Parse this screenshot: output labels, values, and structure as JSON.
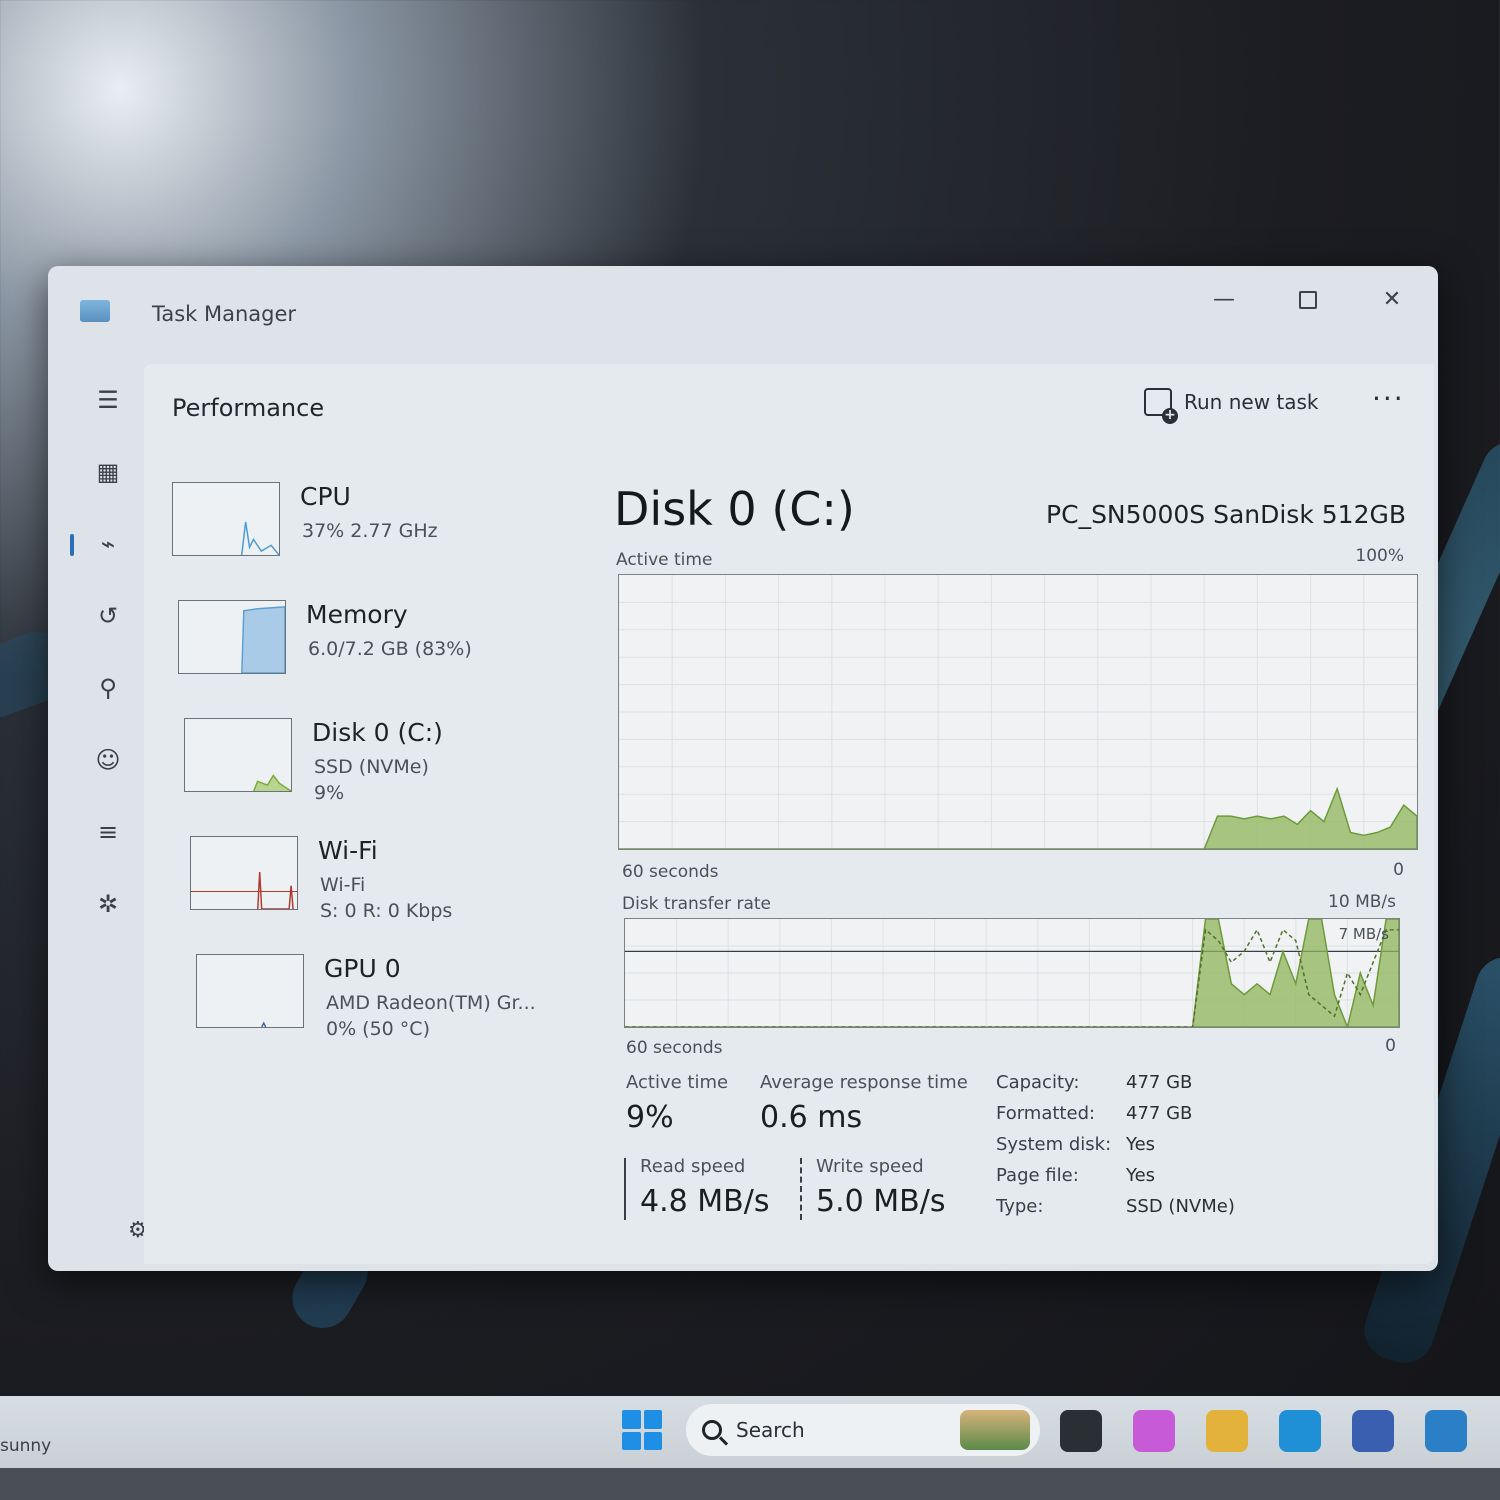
{
  "window": {
    "title": "Task Manager",
    "minimize": "—",
    "close": "✕"
  },
  "header": {
    "section": "Performance",
    "run_new_task": "Run new task",
    "more": "···"
  },
  "nav": {
    "items": [
      {
        "name": "menu",
        "icon": "hamburger-icon",
        "glyph": "☰"
      },
      {
        "name": "processes",
        "icon": "grid-icon",
        "glyph": "▦"
      },
      {
        "name": "performance",
        "icon": "pulse-icon",
        "glyph": "⌁",
        "active": true
      },
      {
        "name": "app-history",
        "icon": "history-icon",
        "glyph": "↺"
      },
      {
        "name": "startup-apps",
        "icon": "speedometer-icon",
        "glyph": "⚲"
      },
      {
        "name": "users",
        "icon": "users-icon",
        "glyph": "☺"
      },
      {
        "name": "details",
        "icon": "list-icon",
        "glyph": "≡"
      },
      {
        "name": "services",
        "icon": "puzzle-icon",
        "glyph": "✲"
      }
    ],
    "settings_glyph": "⚙"
  },
  "devices": [
    {
      "name": "CPU",
      "line1": "37%  2.77 GHz",
      "line2": "",
      "color": "#4a9ad4",
      "util": 0.37
    },
    {
      "name": "Memory",
      "line1": "6.0/7.2 GB (83%)",
      "line2": "",
      "color": "#5b9fd6",
      "util": 0.83
    },
    {
      "name": "Disk 0 (C:)",
      "line1": "SSD (NVMe)",
      "line2": "9%",
      "color": "#7aab3a",
      "util": 0.09
    },
    {
      "name": "Wi-Fi",
      "line1": "Wi-Fi",
      "line2": "S: 0  R: 0 Kbps",
      "color": "#b03a2e",
      "util": 0.0
    },
    {
      "name": "GPU 0",
      "line1": "AMD Radeon(TM) Gr...",
      "line2": "0%  (50 °C)",
      "color": "#3a5fb0",
      "util": 0.0
    }
  ],
  "detail": {
    "title": "Disk 0 (C:)",
    "model": "PC_SN5000S SanDisk 512GB",
    "active_label": "Active time",
    "active_max": "100%",
    "active_x_left": "60 seconds",
    "active_x_right": "0",
    "transfer_label": "Disk transfer rate",
    "transfer_max": "10 MB/s",
    "transfer_mid": "7 MB/s",
    "transfer_x_left": "60 seconds",
    "transfer_x_right": "0",
    "accent": "#8fb55a",
    "active_series": [
      0,
      0,
      0,
      0,
      0,
      0,
      0,
      0,
      0,
      0,
      0,
      0,
      0,
      0,
      0,
      0,
      0,
      0,
      0,
      0,
      0,
      0,
      0,
      0,
      0,
      0,
      0,
      0,
      0,
      0,
      0,
      0,
      0,
      0,
      0,
      0,
      0,
      0,
      0,
      0,
      0,
      0,
      0,
      0,
      0,
      12,
      12,
      11,
      12,
      11,
      12,
      9,
      14,
      10,
      22,
      6,
      5,
      6,
      8,
      16,
      12
    ],
    "transfer_series": [
      0,
      0,
      0,
      0,
      0,
      0,
      0,
      0,
      0,
      0,
      0,
      0,
      0,
      0,
      0,
      0,
      0,
      0,
      0,
      0,
      0,
      0,
      0,
      0,
      0,
      0,
      0,
      0,
      0,
      0,
      0,
      0,
      0,
      0,
      0,
      0,
      0,
      0,
      0,
      0,
      0,
      0,
      0,
      0,
      0,
      10,
      10,
      4,
      3,
      4,
      3,
      7,
      4,
      10,
      10,
      3,
      0,
      5,
      2,
      10,
      10
    ],
    "transfer_dashed": [
      0,
      0,
      0,
      0,
      0,
      0,
      0,
      0,
      0,
      0,
      0,
      0,
      0,
      0,
      0,
      0,
      0,
      0,
      0,
      0,
      0,
      0,
      0,
      0,
      0,
      0,
      0,
      0,
      0,
      0,
      0,
      0,
      0,
      0,
      0,
      0,
      0,
      0,
      0,
      0,
      0,
      0,
      0,
      0,
      0,
      9,
      8,
      6,
      7,
      9,
      6,
      9,
      8,
      3,
      2,
      1,
      5,
      3,
      6,
      9,
      9
    ]
  },
  "stats": {
    "active_time_label": "Active time",
    "active_time_value": "9%",
    "avg_resp_label": "Average response time",
    "avg_resp_value": "0.6 ms",
    "read_label": "Read speed",
    "read_value": "4.8 MB/s",
    "write_label": "Write speed",
    "write_value": "5.0 MB/s",
    "props": [
      {
        "key": "Capacity:",
        "value": "477 GB"
      },
      {
        "key": "Formatted:",
        "value": "477 GB"
      },
      {
        "key": "System disk:",
        "value": "Yes"
      },
      {
        "key": "Page file:",
        "value": "Yes"
      },
      {
        "key": "Type:",
        "value": "SSD (NVMe)"
      }
    ]
  },
  "taskbar": {
    "weather": "sunny",
    "search": "Search",
    "apps": [
      {
        "name": "terminal",
        "icon": "terminal-icon",
        "color": "#2a2f34"
      },
      {
        "name": "copilot",
        "icon": "copilot-icon",
        "color": "#c75ad6"
      },
      {
        "name": "file-explorer",
        "icon": "folder-icon",
        "color": "#e2b23a"
      },
      {
        "name": "edge",
        "icon": "edge-icon",
        "color": "#1f8fd6"
      },
      {
        "name": "store",
        "icon": "store-icon",
        "color": "#3a5fb0"
      },
      {
        "name": "app",
        "icon": "cube-icon",
        "color": "#2a7fc7"
      }
    ]
  }
}
